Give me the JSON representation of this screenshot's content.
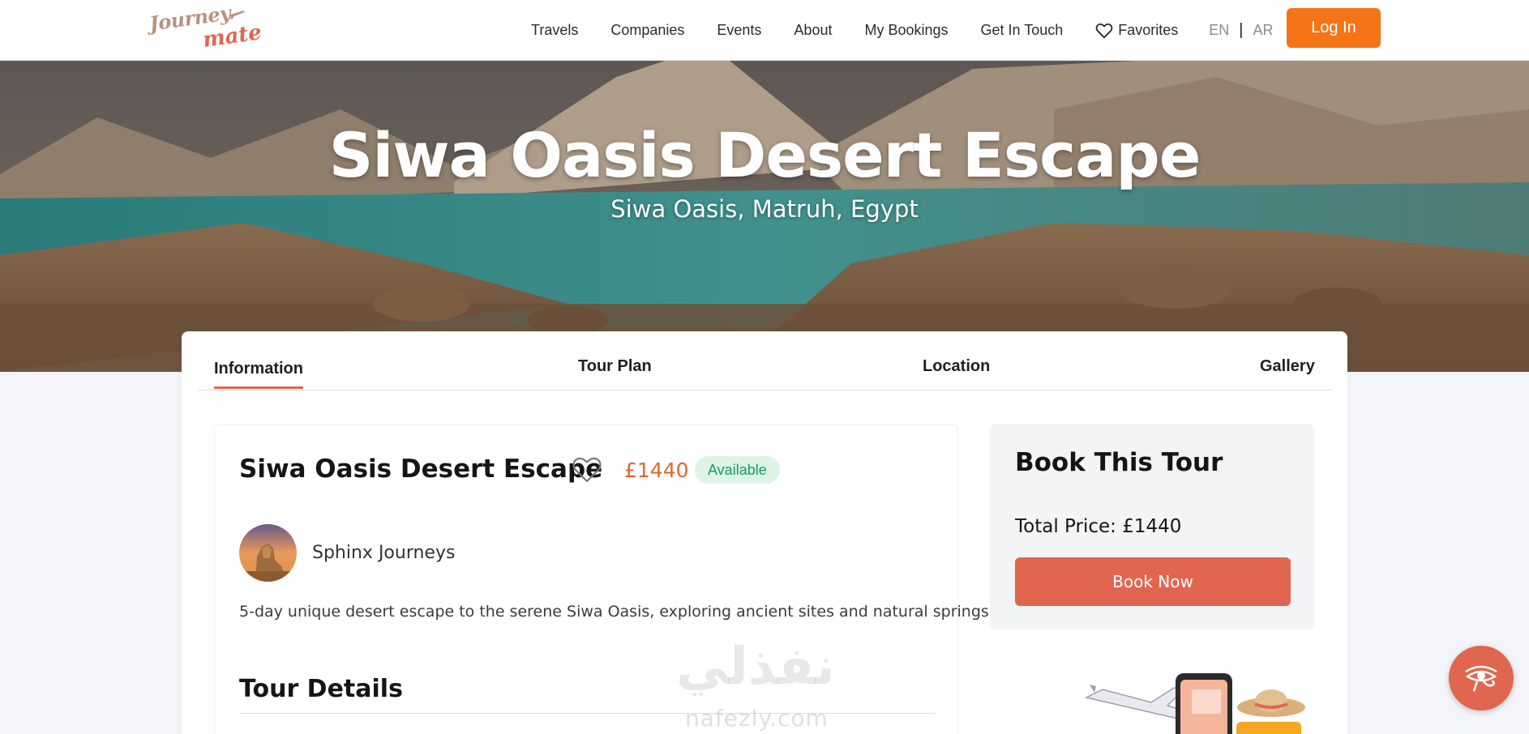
{
  "header": {
    "logo_text_line1": "Journey",
    "logo_text_line2": "mate",
    "nav_items": [
      "Travels",
      "Companies",
      "Events",
      "About",
      "My Bookings",
      "Get In Touch"
    ],
    "favorites_label": "Favorites",
    "lang_en": "EN",
    "lang_sep": "|",
    "lang_ar": "AR",
    "login_label": "Log In"
  },
  "hero": {
    "title": "Siwa Oasis Desert Escape",
    "subtitle": "Siwa Oasis, Matruh, Egypt"
  },
  "tabs": [
    {
      "label": "Information",
      "active": true
    },
    {
      "label": "Tour Plan",
      "active": false
    },
    {
      "label": "Location",
      "active": false
    },
    {
      "label": "Gallery",
      "active": false
    }
  ],
  "tour": {
    "title": "Siwa Oasis Desert Escape",
    "price": "£1440",
    "status": "Available",
    "company": "Sphinx Journeys",
    "description": "5-day unique desert escape to the serene Siwa Oasis, exploring ancient sites and natural springs.",
    "details_heading": "Tour Details"
  },
  "booking": {
    "title": "Book This Tour",
    "total_price": "Total Price: £1440",
    "book_label": "Book Now"
  },
  "watermark": {
    "arabic": "نفذلي",
    "latin": "nafezly.com"
  },
  "colors": {
    "brand_orange": "#f47416",
    "accent_coral": "#e0664f",
    "price_orange": "#e1652b",
    "available_green": "#1d9a57",
    "available_bg": "#dcf5e7"
  },
  "icons": {
    "favorites": "heart-outline-icon",
    "floating_button": "eye-of-horus-icon"
  }
}
